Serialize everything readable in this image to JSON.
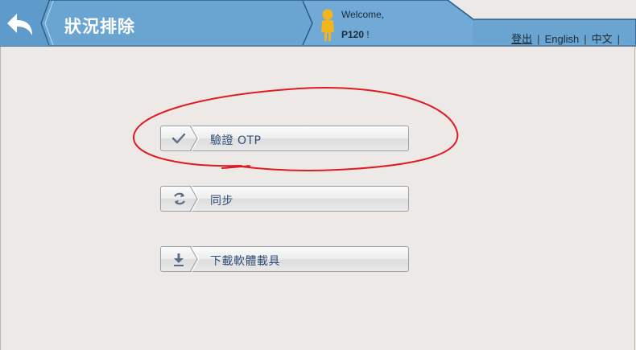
{
  "header": {
    "title": "狀況排除",
    "welcome": "Welcome,",
    "user": "P120",
    "user_suffix": "!",
    "links": {
      "logout": "登出",
      "english": "English",
      "chinese": "中文",
      "separator": "|"
    },
    "colors": {
      "bar": "#5f9ccb",
      "accent_dark": "#274d72"
    }
  },
  "menu": {
    "items": [
      {
        "label": "驗證 OTP",
        "icon": "checkmark-icon"
      },
      {
        "label": "同步",
        "icon": "sync-icon"
      },
      {
        "label": "下載軟體載具",
        "icon": "download-icon"
      }
    ]
  },
  "annotation": {
    "color": "#e01b24",
    "target": "驗證 OTP"
  }
}
